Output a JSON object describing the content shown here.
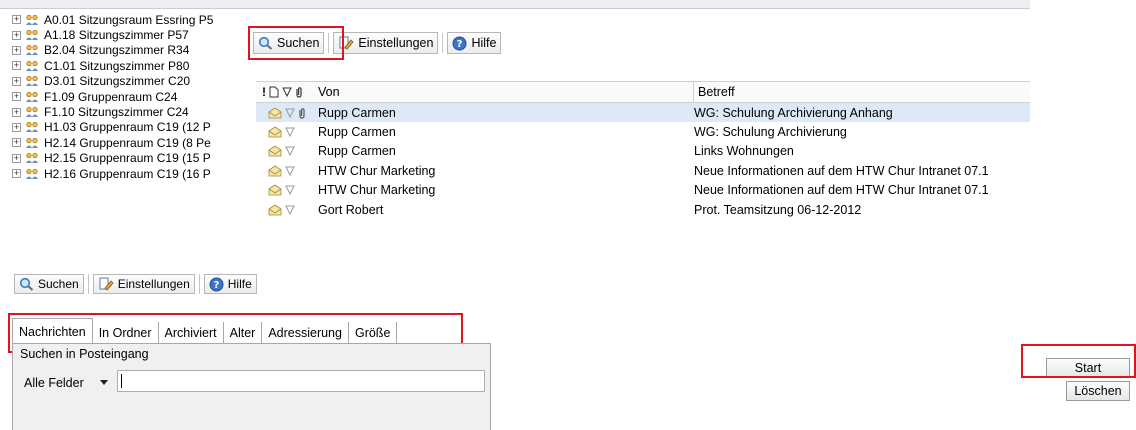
{
  "toolbar": {
    "search_label": "Suchen",
    "settings_label": "Einstellungen",
    "help_label": "Hilfe"
  },
  "tree": {
    "items": [
      {
        "label": "A0.01 Sitzungsraum Essring P5"
      },
      {
        "label": "A1.18 Sitzungszimmer P57"
      },
      {
        "label": "B2.04 Sitzungszimmer R34"
      },
      {
        "label": "C1.01 Sitzungszimmer P80"
      },
      {
        "label": "D3.01 Sitzungszimmer C20"
      },
      {
        "label": "F1.09 Gruppenraum C24"
      },
      {
        "label": "F1.10 Sitzungszimmer C24"
      },
      {
        "label": "H1.03 Gruppenraum C19 (12 P"
      },
      {
        "label": "H2.14 Gruppenraum C19 (8 Pe"
      },
      {
        "label": "H2.15 Gruppenraum C19 (15 P"
      },
      {
        "label": "H2.16 Gruppenraum C19 (16 P"
      }
    ]
  },
  "mail": {
    "header_icons": "! 🗋 ⊽ 0",
    "col_from": "Von",
    "col_subject": "Betreff",
    "rows": [
      {
        "from": "Rupp Carmen",
        "subject": "WG: Schulung Archivierung Anhang",
        "attachment": true,
        "selected": true
      },
      {
        "from": "Rupp Carmen",
        "subject": "WG: Schulung Archivierung",
        "attachment": false
      },
      {
        "from": "Rupp Carmen",
        "subject": "Links Wohnungen",
        "attachment": false
      },
      {
        "from": "HTW Chur Marketing",
        "subject": "Neue Informationen auf dem HTW Chur Intranet 07.1",
        "attachment": false
      },
      {
        "from": "HTW Chur Marketing",
        "subject": "Neue Informationen auf dem HTW Chur Intranet 07.1",
        "attachment": false
      },
      {
        "from": "Gort Robert",
        "subject": "Prot. Teamsitzung 06-12-2012",
        "attachment": false
      }
    ]
  },
  "search": {
    "tabs": [
      "Nachrichten",
      "In Ordner",
      "Archiviert",
      "Alter",
      "Adressierung",
      "Größe"
    ],
    "active_tab": "Nachrichten",
    "search_in_label": "Suchen in Posteingang",
    "field_select_value": "Alle Felder",
    "query_value": "",
    "start_label": "Start",
    "clear_label": "Löschen"
  },
  "colors": {
    "highlight_red": "#e0141e",
    "selection_row": "#dde9f7"
  }
}
